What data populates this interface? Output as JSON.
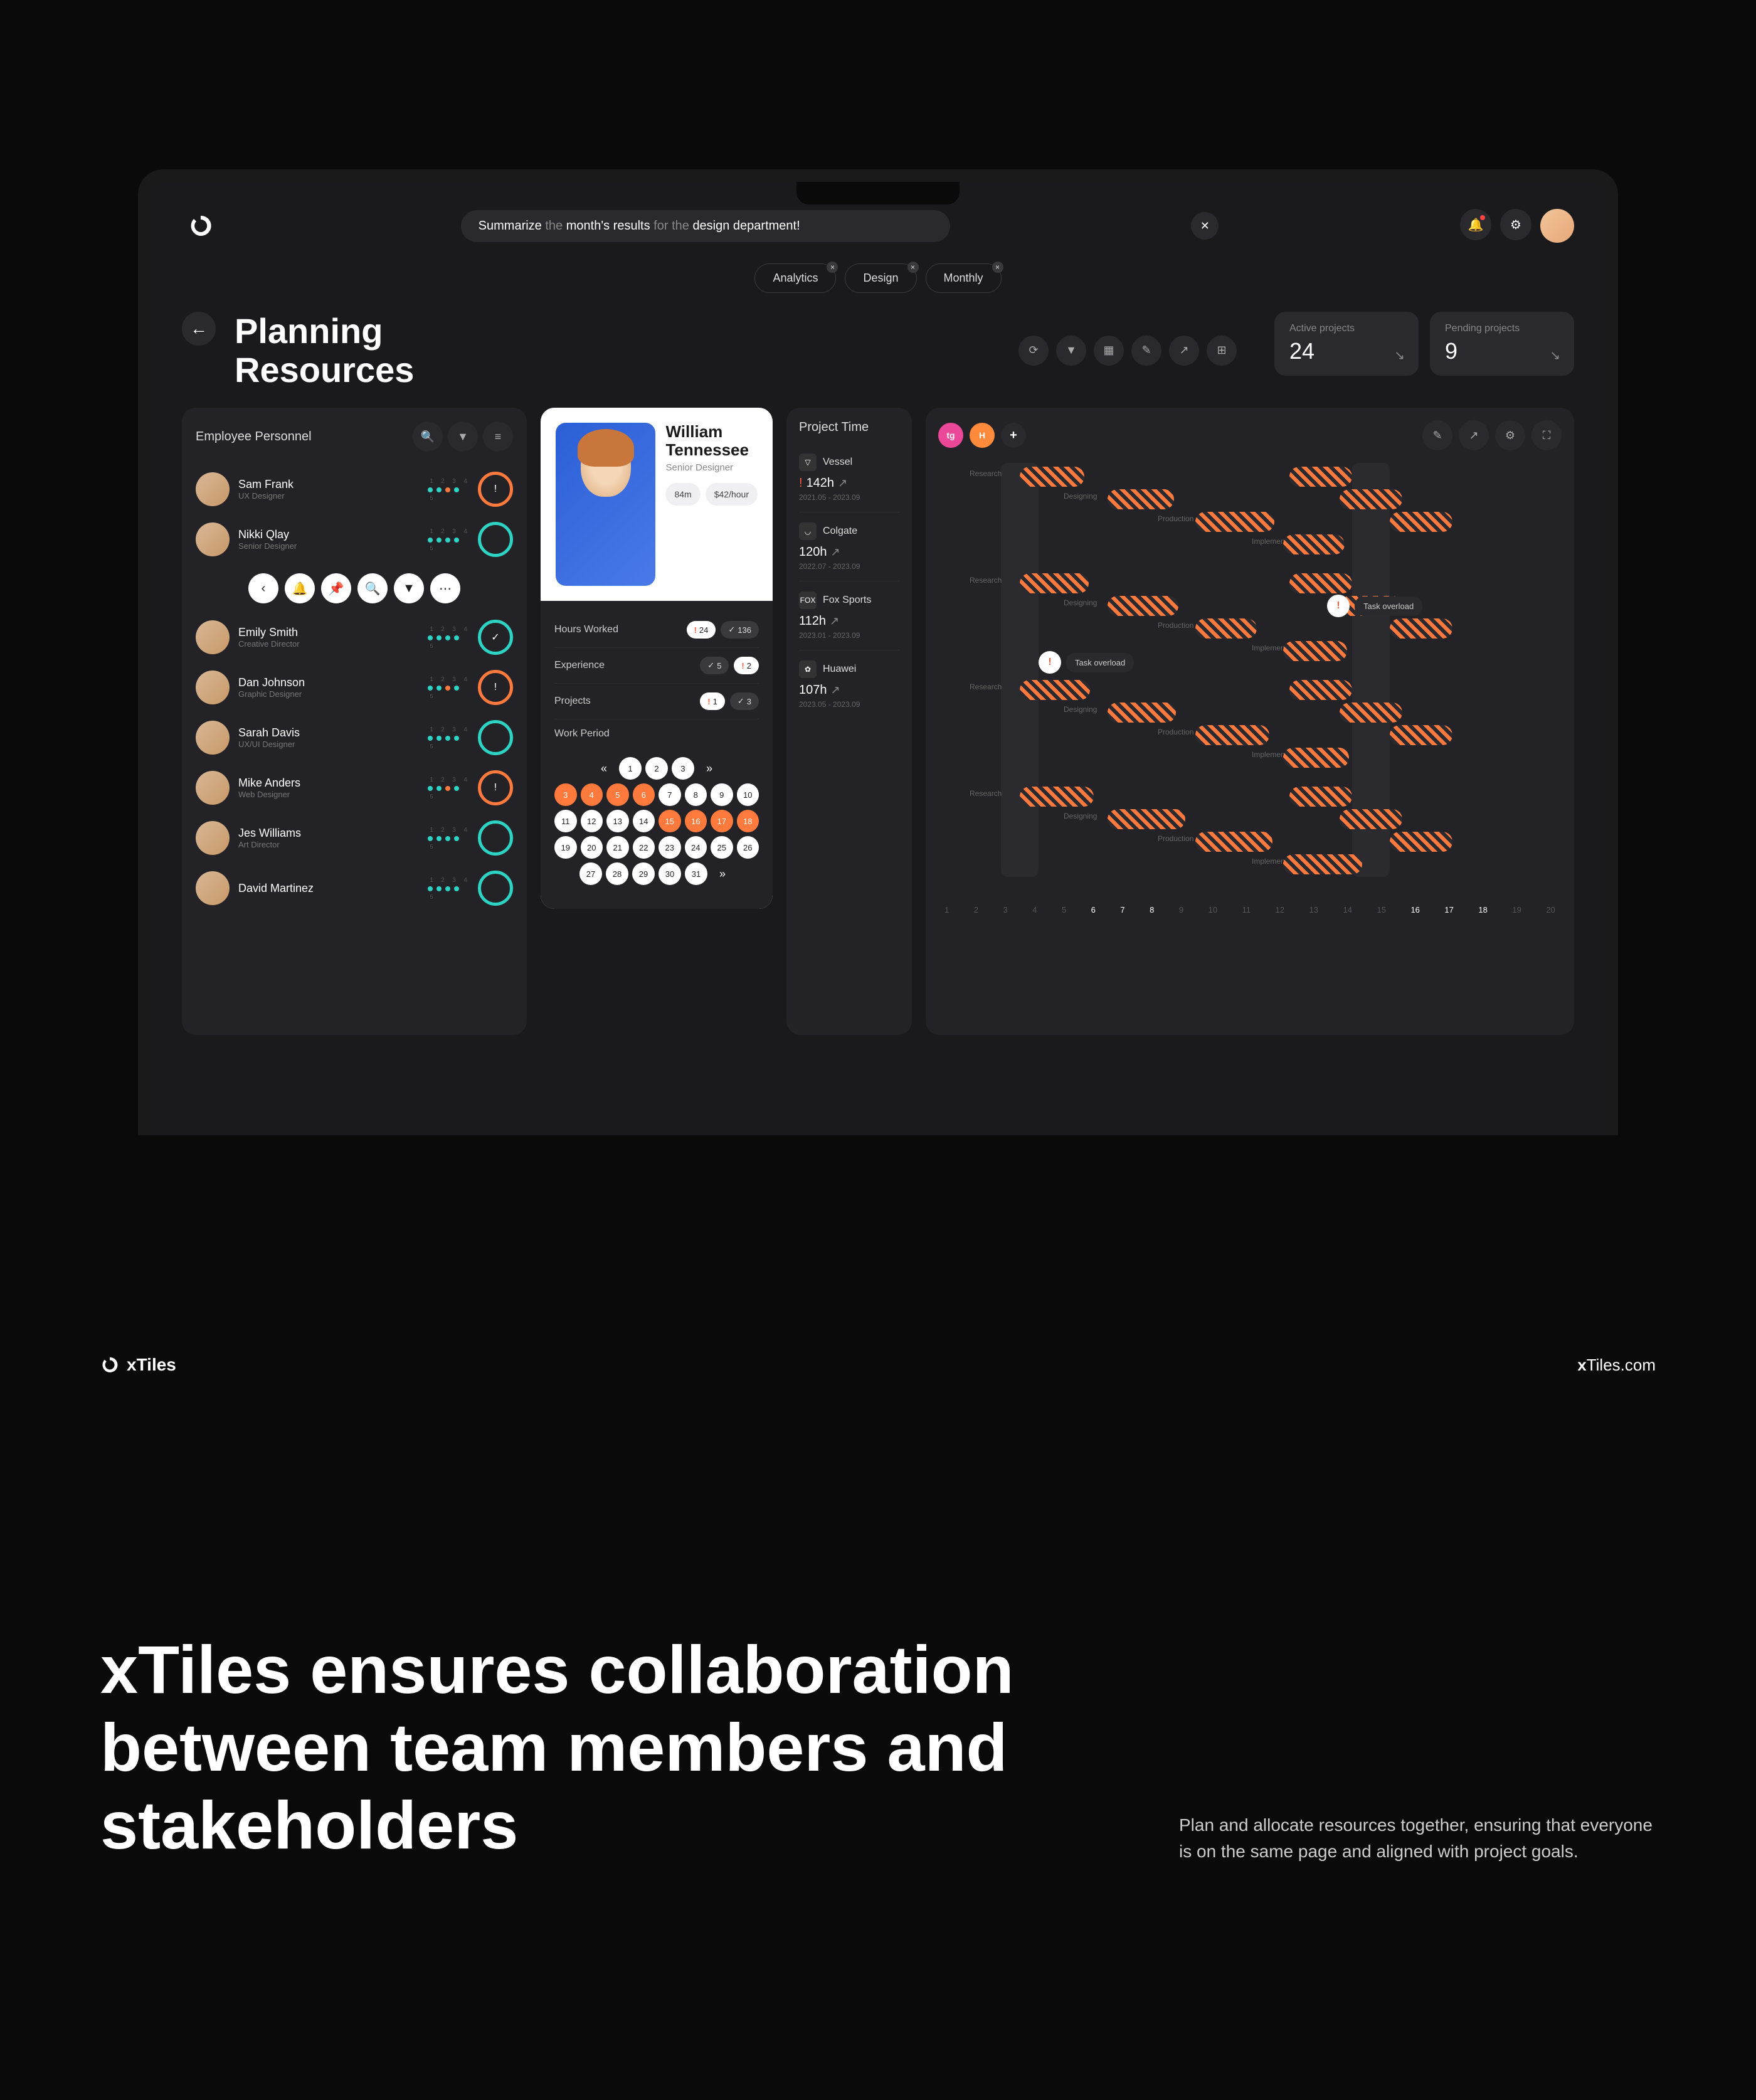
{
  "brand": "xTiles",
  "brandUrl": "xTiles.com",
  "search": {
    "prefix": "Summarize",
    "mid1": "the",
    "bold1": "month's results",
    "mid2": "for the",
    "bold2": "design department!"
  },
  "chips": [
    "Analytics",
    "Design",
    "Monthly"
  ],
  "pageTitle1": "Planning",
  "pageTitle2": "Resources",
  "stats": [
    {
      "label": "Active projects",
      "value": "24"
    },
    {
      "label": "Pending projects",
      "value": "9"
    }
  ],
  "employeePanel": {
    "title": "Employee Personnel"
  },
  "employees": [
    {
      "name": "Sam Frank",
      "role": "UX Designer",
      "alert": true
    },
    {
      "name": "Nikki Qlay",
      "role": "Senior Designer",
      "alert": false
    },
    {
      "name": "Emily Smith",
      "role": "Creative Director",
      "alert": false,
      "check": true
    },
    {
      "name": "Dan Johnson",
      "role": "Graphic Designer",
      "alert": true
    },
    {
      "name": "Sarah Davis",
      "role": "UX/UI Designer",
      "alert": false
    },
    {
      "name": "Mike Anders",
      "role": "Web Designer",
      "alert": true
    },
    {
      "name": "Jes Williams",
      "role": "Art Director",
      "alert": false
    },
    {
      "name": "David Martinez",
      "role": "",
      "alert": false
    }
  ],
  "profile": {
    "name": "William Tennessee",
    "role": "Senior Designer",
    "duration": "84m",
    "rate": "$42/hour"
  },
  "metrics": {
    "hoursLabel": "Hours Worked",
    "hoursWarn": "24",
    "hoursCheck": "136",
    "expLabel": "Experience",
    "expCheck": "5",
    "expWarn": "2",
    "projLabel": "Projects",
    "projWarn": "1",
    "projCheck": "3",
    "periodLabel": "Work Period"
  },
  "calendar": [
    [
      "«",
      "1",
      "2",
      "3",
      "»"
    ],
    [
      "3",
      "4",
      "5",
      "6",
      "7",
      "8",
      "9",
      "10"
    ],
    [
      "11",
      "12",
      "13",
      "14",
      "15",
      "16",
      "17",
      "18"
    ],
    [
      "19",
      "20",
      "21",
      "22",
      "23",
      "24",
      "25",
      "26"
    ],
    [
      "27",
      "28",
      "29",
      "30",
      "31",
      "»"
    ]
  ],
  "calendarOrange": [
    "3",
    "4",
    "5",
    "6",
    "15",
    "16",
    "17",
    "18"
  ],
  "projectTime": {
    "title": "Project Time"
  },
  "projects": [
    {
      "icon": "▽",
      "name": "Vessel",
      "hours": "142h",
      "warn": true,
      "dates": "2021.05 - 2023.09"
    },
    {
      "icon": "◡",
      "name": "Colgate",
      "hours": "120h",
      "dates": "2022.07 - 2023.09"
    },
    {
      "icon": "FOX",
      "name": "Fox Sports",
      "hours": "112h",
      "dates": "2023.01 - 2023.09"
    },
    {
      "icon": "✿",
      "name": "Huawei",
      "hours": "107h",
      "dates": "2023.05 - 2023.09"
    }
  ],
  "timeline": {
    "phases": [
      "Research",
      "Designing",
      "Production",
      "Implementation"
    ],
    "taskOverload": "Task overload",
    "axis": [
      "1",
      "2",
      "3",
      "4",
      "5",
      "6",
      "7",
      "8",
      "9",
      "10",
      "11",
      "12",
      "13",
      "14",
      "15",
      "16",
      "17",
      "18",
      "19",
      "20"
    ],
    "activeRange": [
      6,
      8
    ],
    "activeRange2": [
      16,
      18
    ]
  },
  "headline": {
    "bold": "x",
    "rest": "Tiles ensures collaboration between team members and stakeholders"
  },
  "sub": "Plan and allocate resources together, ensuring that everyone is on the same page and aligned with project goals."
}
